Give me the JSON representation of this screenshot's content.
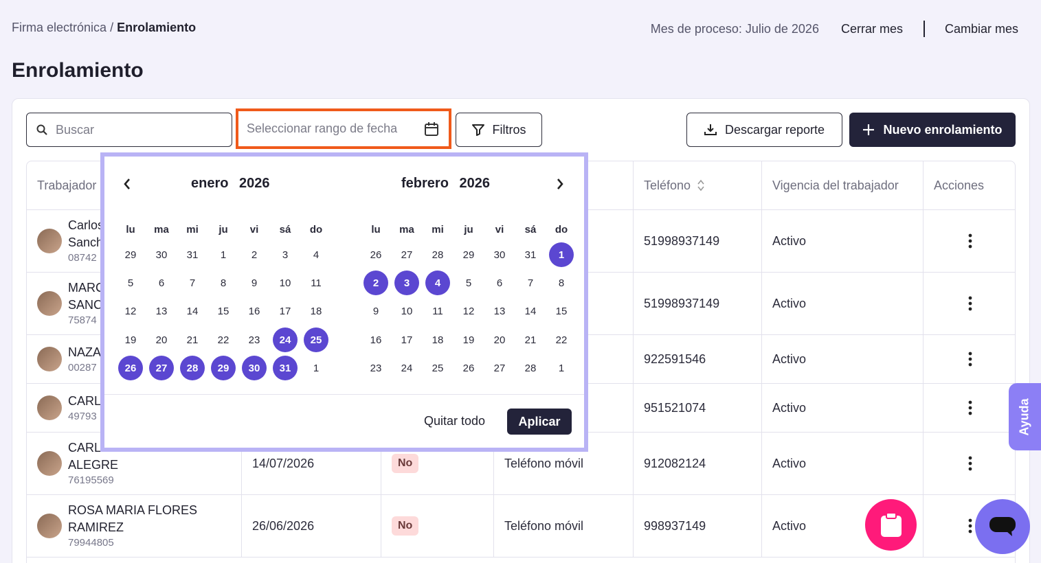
{
  "header": {
    "breadcrumb_parent": "Firma electrónica",
    "breadcrumb_sep": "/",
    "breadcrumb_current": "Enrolamiento",
    "process_month": "Mes de proceso: Julio de 2026",
    "close_month": "Cerrar mes",
    "change_month": "Cambiar mes",
    "title": "Enrolamiento"
  },
  "toolbar": {
    "search_placeholder": "Buscar",
    "date_placeholder": "Seleccionar rango de fecha",
    "filters": "Filtros",
    "download": "Descargar reporte",
    "new": "Nuevo enrolamiento"
  },
  "table": {
    "headers": [
      "Trabajador",
      "Teléfono",
      "Vigencia del trabajador",
      "Acciones"
    ],
    "rows": [
      {
        "name1": "Carlos",
        "name2": "Sanch",
        "dni": "08742",
        "date": "",
        "signed": "",
        "device": "",
        "phone": "51998937149",
        "status": "Activo"
      },
      {
        "name1": "MARC",
        "name2": "SANC",
        "dni": "75874",
        "date": "",
        "signed": "",
        "device": "",
        "phone": "51998937149",
        "status": "Activo"
      },
      {
        "name1": "NAZA",
        "name2": "",
        "dni": "00287",
        "date": "",
        "signed": "",
        "device": "",
        "phone": "922591546",
        "status": "Activo"
      },
      {
        "name1": "CARL",
        "name2": "",
        "dni": "49793",
        "date": "",
        "signed": "",
        "device": "",
        "phone": "951521074",
        "status": "Activo"
      },
      {
        "name1": "CARL",
        "name2": "ALEGRE",
        "dni": "76195569",
        "date": "14/07/2026",
        "signed": "No",
        "device": "Teléfono móvil",
        "phone": "912082124",
        "status": "Activo"
      },
      {
        "name1": "ROSA MARIA FLORES",
        "name2": "RAMIREZ",
        "dni": "79944805",
        "date": "26/06/2026",
        "signed": "No",
        "device": "Teléfono móvil",
        "phone": "998937149",
        "status": "Activo"
      }
    ]
  },
  "calendar": {
    "left_month": "enero",
    "left_year": "2026",
    "right_month": "febrero",
    "right_year": "2026",
    "weekdays": [
      "lu",
      "ma",
      "mi",
      "ju",
      "vi",
      "sá",
      "do"
    ],
    "left_days": [
      [
        "29",
        "30",
        "31",
        "1",
        "2",
        "3",
        "4"
      ],
      [
        "5",
        "6",
        "7",
        "8",
        "9",
        "10",
        "11"
      ],
      [
        "12",
        "13",
        "14",
        "15",
        "16",
        "17",
        "18"
      ],
      [
        "19",
        "20",
        "21",
        "22",
        "23",
        "24",
        "25"
      ],
      [
        "26",
        "27",
        "28",
        "29",
        "30",
        "31",
        "1"
      ]
    ],
    "left_selected": [
      "24",
      "25",
      "26",
      "27",
      "28",
      "29",
      "30",
      "31"
    ],
    "right_days": [
      [
        "26",
        "27",
        "28",
        "29",
        "30",
        "31",
        "1"
      ],
      [
        "2",
        "3",
        "4",
        "5",
        "6",
        "7",
        "8"
      ],
      [
        "9",
        "10",
        "11",
        "12",
        "13",
        "14",
        "15"
      ],
      [
        "16",
        "17",
        "18",
        "19",
        "20",
        "21",
        "22"
      ],
      [
        "23",
        "24",
        "25",
        "26",
        "27",
        "28",
        "1"
      ]
    ],
    "right_selected": [
      "1",
      "2",
      "3",
      "4"
    ],
    "clear": "Quitar todo",
    "apply": "Aplicar"
  },
  "help": "Ayuda",
  "colors": {
    "accent": "#5b47d1",
    "highlight": "#f05a1a",
    "dark": "#23233a",
    "pink": "#ff1a7a"
  }
}
